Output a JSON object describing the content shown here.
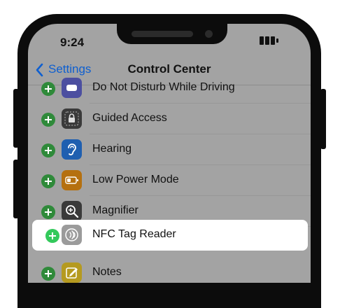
{
  "status_bar": {
    "time": "9:24",
    "battery_icon": "battery-full-icon"
  },
  "nav": {
    "back_label": "Settings",
    "title": "Control Center"
  },
  "colors": {
    "screen_dim": "#a3a3a3",
    "accent_blue": "#0e5fd0",
    "add_green": "#33c95b"
  },
  "items": [
    {
      "label": "Do Not Disturb While Driving",
      "icon": "car-icon",
      "color": "#4c4fa0"
    },
    {
      "label": "Guided Access",
      "icon": "lock-icon",
      "color": "#3a3a3a"
    },
    {
      "label": "Hearing",
      "icon": "ear-icon",
      "color": "#1f5fb0"
    },
    {
      "label": "Low Power Mode",
      "icon": "battery-icon",
      "color": "#b5700f"
    },
    {
      "label": "Magnifier",
      "icon": "magnifier-icon",
      "color": "#3a3a3a"
    },
    {
      "label": "NFC Tag Reader",
      "icon": "nfc-icon",
      "color": "#9b9b9b",
      "highlighted": true
    },
    {
      "label": "Notes",
      "icon": "notes-icon",
      "color": "#b59a20"
    }
  ]
}
